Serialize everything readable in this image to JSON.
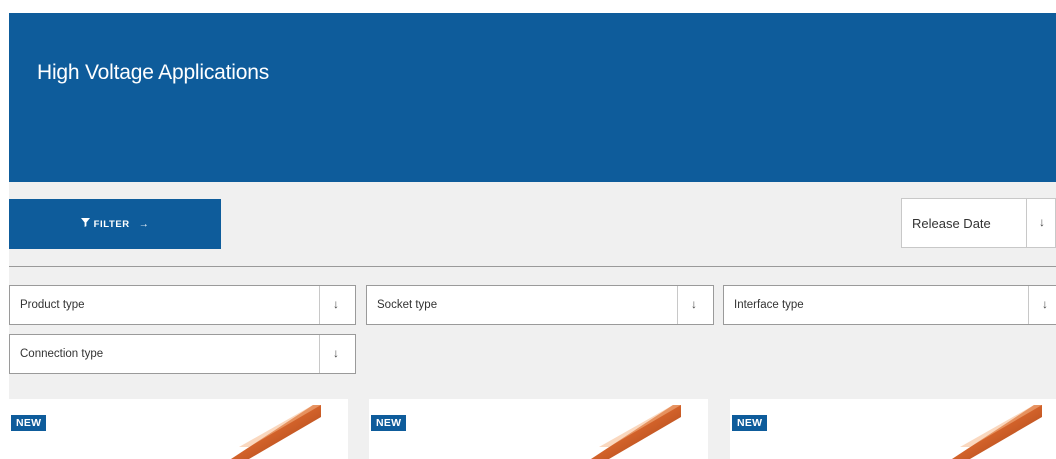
{
  "hero": {
    "title": "High Voltage Applications",
    "background": "#0e5c9b"
  },
  "toolbar": {
    "filter_label": "FILTER",
    "filter_arrow": "→",
    "sort": {
      "selected": "Release Date",
      "chevron": "↓"
    }
  },
  "filters": [
    {
      "label": "Product type",
      "chevron": "↓"
    },
    {
      "label": "Socket type",
      "chevron": "↓"
    },
    {
      "label": "Interface type",
      "chevron": "↓"
    },
    {
      "label": "Connection type",
      "chevron": "↓"
    }
  ],
  "products": [
    {
      "badge": "NEW",
      "image": "copper-busbar-image"
    },
    {
      "badge": "NEW",
      "image": "copper-busbar-image"
    },
    {
      "badge": "NEW",
      "image": "copper-busbar-image"
    }
  ],
  "colors": {
    "brand": "#0e5c9b",
    "page_bg": "#f0f0f0",
    "badge": "#0e5c9b"
  }
}
